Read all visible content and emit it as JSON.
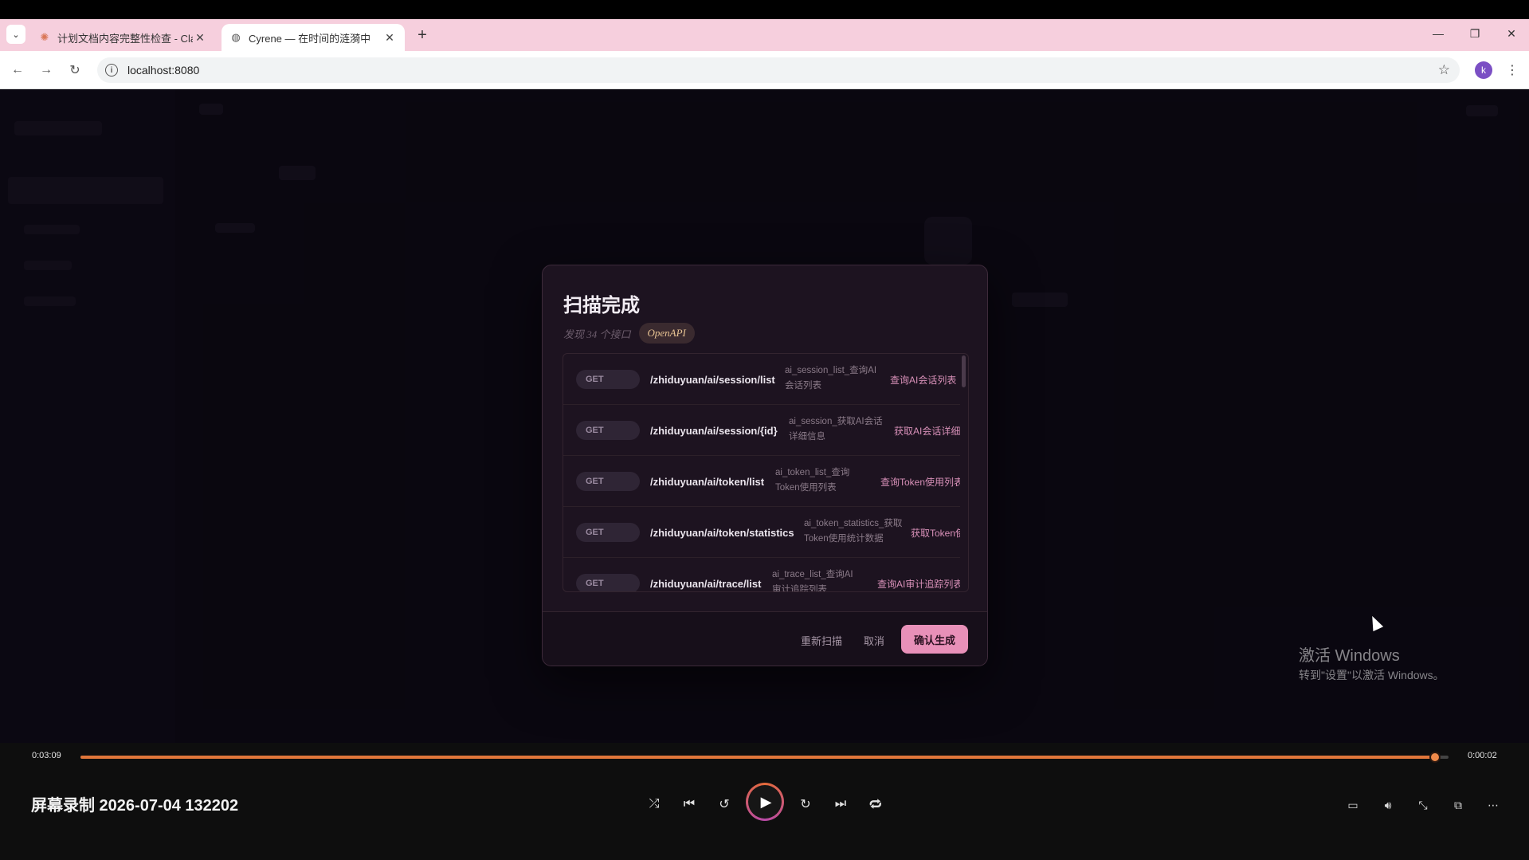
{
  "browser": {
    "tabs": [
      {
        "title": "计划文档内容完整性检查 - Cla",
        "icon": "claude-asterisk-icon"
      },
      {
        "title": "Cyrene — 在时间的涟漪中",
        "icon": "globe-icon"
      }
    ],
    "new_tab": "+",
    "url": "localhost:8080",
    "profile_initial": "k",
    "window_controls": {
      "minimize": "—",
      "restore": "❐",
      "close": "✕"
    }
  },
  "modal": {
    "title": "扫描完成",
    "found_text": "发现 34 个接口",
    "badge": "OpenAPI",
    "endpoints": [
      {
        "method": "GET",
        "path": "/zhiduyuan/ai/session/list",
        "operation": "ai_session_list_查询AI会话列表",
        "summary": "查询AI会话列表"
      },
      {
        "method": "GET",
        "path": "/zhiduyuan/ai/session/{id}",
        "operation": "ai_session_获取AI会话详细信息",
        "summary": "获取AI会话详细"
      },
      {
        "method": "GET",
        "path": "/zhiduyuan/ai/token/list",
        "operation": "ai_token_list_查询Token使用列表",
        "summary": "查询Token使用列表"
      },
      {
        "method": "GET",
        "path": "/zhiduyuan/ai/token/statistics",
        "operation": "ai_token_statistics_获取Token使用统计数据",
        "summary": "获取Token使"
      },
      {
        "method": "GET",
        "path": "/zhiduyuan/ai/trace/list",
        "operation": "ai_trace_list_查询AI审计追踪列表",
        "summary": "查询AI审计追踪列表"
      }
    ],
    "buttons": {
      "rescan": "重新扫描",
      "cancel": "取消",
      "confirm": "确认生成"
    }
  },
  "player": {
    "elapsed": "0:03:09",
    "remaining": "0:00:02",
    "progress_fraction": 0.99,
    "title": "屏幕录制 2026-07-04 132202",
    "controls": [
      "shuffle-icon",
      "previous-icon",
      "rewind-10-icon",
      "play-icon",
      "forward-30-icon",
      "next-icon",
      "repeat-icon"
    ],
    "right_controls": [
      "subtitles-icon",
      "volume-icon",
      "minimize-player-icon",
      "mini-view-icon",
      "more-icon"
    ]
  },
  "watermark": {
    "line1": "激活 Windows",
    "line2": "转到\"设置\"以激活 Windows。"
  },
  "colors": {
    "tabbar": "#f6cfdd",
    "accent_pink": "#e890b8",
    "progress": "#e0763a",
    "modal_bg": "#1d1320"
  }
}
